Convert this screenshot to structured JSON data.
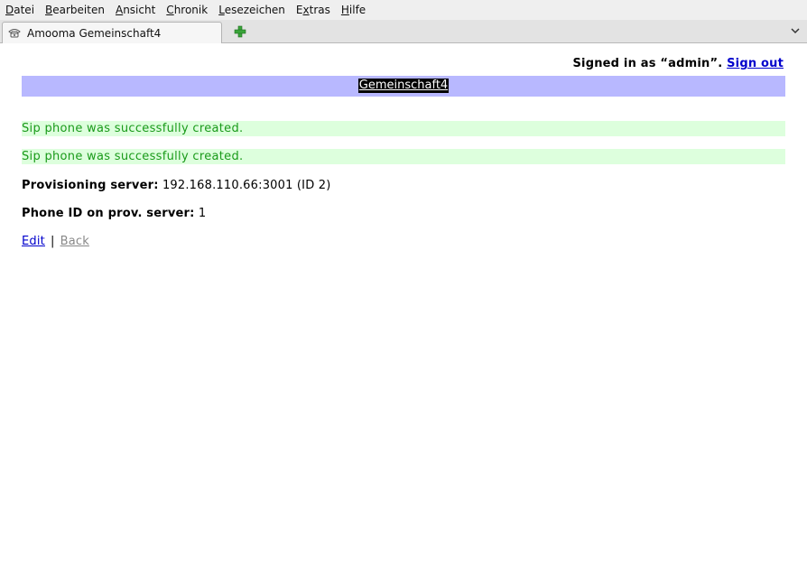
{
  "menubar": {
    "items": [
      {
        "accel": "D",
        "rest": "atei"
      },
      {
        "accel": "B",
        "rest": "earbeiten"
      },
      {
        "accel": "A",
        "rest": "nsicht"
      },
      {
        "accel": "C",
        "rest": "hronik"
      },
      {
        "accel": "L",
        "rest": "esezeichen"
      },
      {
        "accel": "",
        "rest": "Extras"
      },
      {
        "accel": "H",
        "rest": "ilfe"
      }
    ]
  },
  "tab": {
    "title": "Amooma Gemeinschaft4"
  },
  "session": {
    "signed_in_prefix": "Signed in as “admin”.",
    "sign_out": "Sign out"
  },
  "header": {
    "link": "Gemeinschaft4"
  },
  "flash": [
    "Sip phone was successfully created.",
    "Sip phone was successfully created."
  ],
  "details": {
    "prov_label": "Provisioning server:",
    "prov_value": "192.168.110.66:3001 (ID 2)",
    "phone_label": "Phone ID on prov. server:",
    "phone_value": "1"
  },
  "actions": {
    "edit": "Edit",
    "separator": "|",
    "back": "Back"
  },
  "colors": {
    "header_bar": "#b8b8ff",
    "flash_bg": "#ddffdd",
    "flash_text": "#1a9a1a",
    "link": "#0000cc"
  }
}
